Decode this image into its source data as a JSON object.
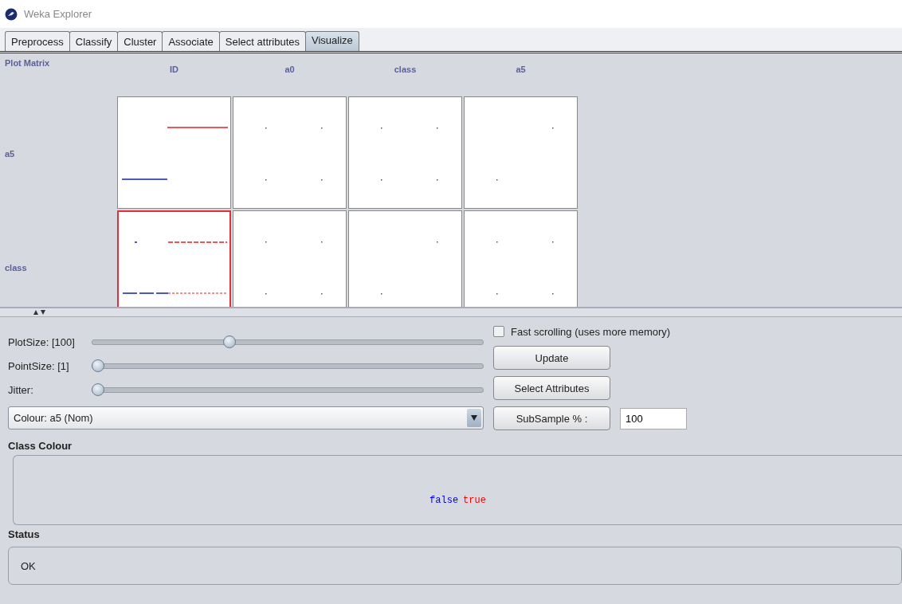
{
  "window": {
    "title": "Weka Explorer"
  },
  "tabs": [
    {
      "label": "Preprocess",
      "selected": false
    },
    {
      "label": "Classify",
      "selected": false
    },
    {
      "label": "Cluster",
      "selected": false
    },
    {
      "label": "Associate",
      "selected": false
    },
    {
      "label": "Select attributes",
      "selected": false
    },
    {
      "label": "Visualize",
      "selected": true
    }
  ],
  "plot_matrix": {
    "title": "Plot Matrix",
    "columns": [
      "ID",
      "a0",
      "class",
      "a5"
    ],
    "rows": [
      {
        "label": "a5",
        "cells": [
          {
            "selected": false
          },
          {
            "selected": false
          },
          {
            "selected": false
          },
          {
            "selected": false
          }
        ]
      },
      {
        "label": "class",
        "cells": [
          {
            "selected": true
          },
          {
            "selected": false
          },
          {
            "selected": false
          },
          {
            "selected": false
          }
        ]
      }
    ]
  },
  "sliders": [
    {
      "label": "PlotSize: [100]",
      "level": 0.35
    },
    {
      "label": "PointSize: [1]",
      "level": 0
    },
    {
      "label": "Jitter:",
      "level": 0
    }
  ],
  "colour_dropdown": {
    "value": "Colour: a5  (Nom)"
  },
  "fast_scrolling": {
    "label": "Fast scrolling (uses more memory)",
    "checked": false
  },
  "buttons": [
    "Update",
    "Select Attributes"
  ],
  "subsample": {
    "label": "SubSample % :",
    "value": "100"
  },
  "class_colour": {
    "title": "Class Colour",
    "classes": [
      {
        "label": "false",
        "color": "#0000ff"
      },
      {
        "label": "true",
        "color": "#ff0000"
      }
    ]
  },
  "status": {
    "title": "Status",
    "text": "OK"
  }
}
